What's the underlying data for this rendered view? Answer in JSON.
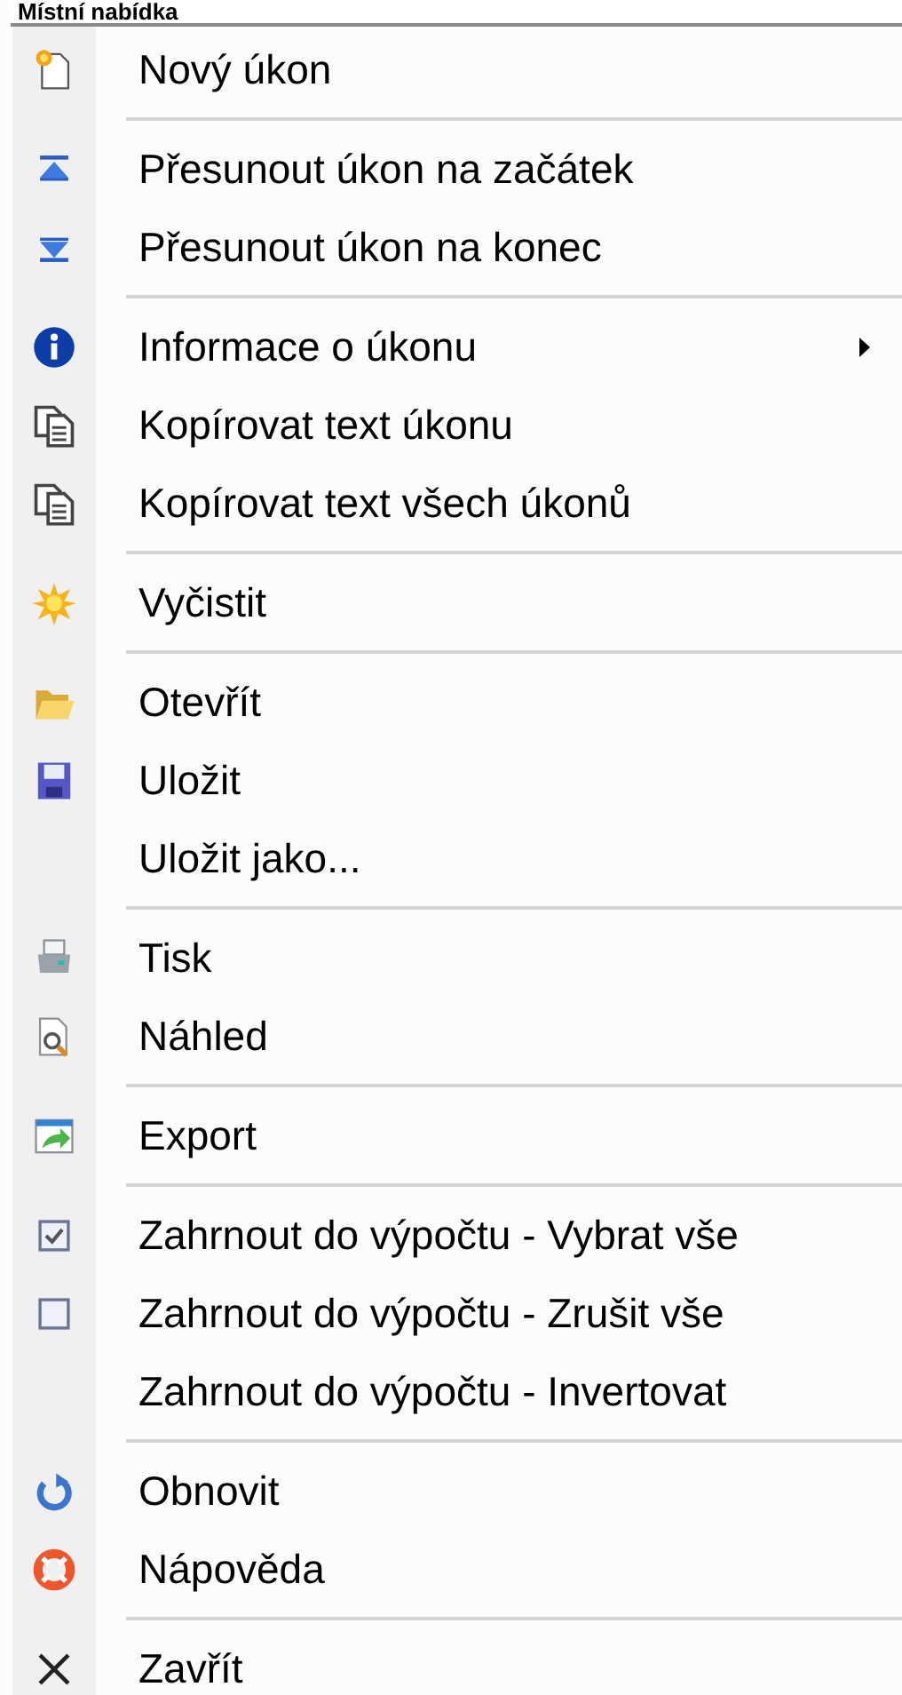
{
  "title": "Místní nabídka",
  "entries": [
    {
      "kind": "new",
      "label": "Nový úkon",
      "submenu": false
    },
    {
      "kind": "separator"
    },
    {
      "kind": "top",
      "label": "Přesunout úkon na začátek",
      "submenu": false
    },
    {
      "kind": "bottom",
      "label": "Přesunout úkon na konec",
      "submenu": false
    },
    {
      "kind": "separator"
    },
    {
      "kind": "info",
      "label": "Informace o úkonu",
      "submenu": true
    },
    {
      "kind": "copy",
      "label": "Kopírovat text úkonu",
      "submenu": false
    },
    {
      "kind": "copy",
      "label": "Kopírovat text všech úkonů",
      "submenu": false
    },
    {
      "kind": "separator"
    },
    {
      "kind": "clear",
      "label": "Vyčistit",
      "submenu": false
    },
    {
      "kind": "separator"
    },
    {
      "kind": "open",
      "label": "Otevřít",
      "submenu": false
    },
    {
      "kind": "save",
      "label": "Uložit",
      "submenu": false
    },
    {
      "kind": "plain",
      "label": "Uložit jako...",
      "submenu": false
    },
    {
      "kind": "separator"
    },
    {
      "kind": "print",
      "label": "Tisk",
      "submenu": false
    },
    {
      "kind": "preview",
      "label": "Náhled",
      "submenu": false
    },
    {
      "kind": "separator"
    },
    {
      "kind": "export",
      "label": "Export",
      "submenu": false
    },
    {
      "kind": "separator"
    },
    {
      "kind": "checked",
      "label": "Zahrnout do výpočtu - Vybrat vše",
      "submenu": false
    },
    {
      "kind": "unchecked",
      "label": "Zahrnout do výpočtu - Zrušit vše",
      "submenu": false
    },
    {
      "kind": "plain",
      "label": "Zahrnout do výpočtu - Invertovat",
      "submenu": false
    },
    {
      "kind": "separator"
    },
    {
      "kind": "refresh",
      "label": "Obnovit",
      "submenu": false
    },
    {
      "kind": "help",
      "label": "Nápověda",
      "submenu": false
    },
    {
      "kind": "separator"
    },
    {
      "kind": "close",
      "label": "Zavřít",
      "submenu": false
    }
  ]
}
